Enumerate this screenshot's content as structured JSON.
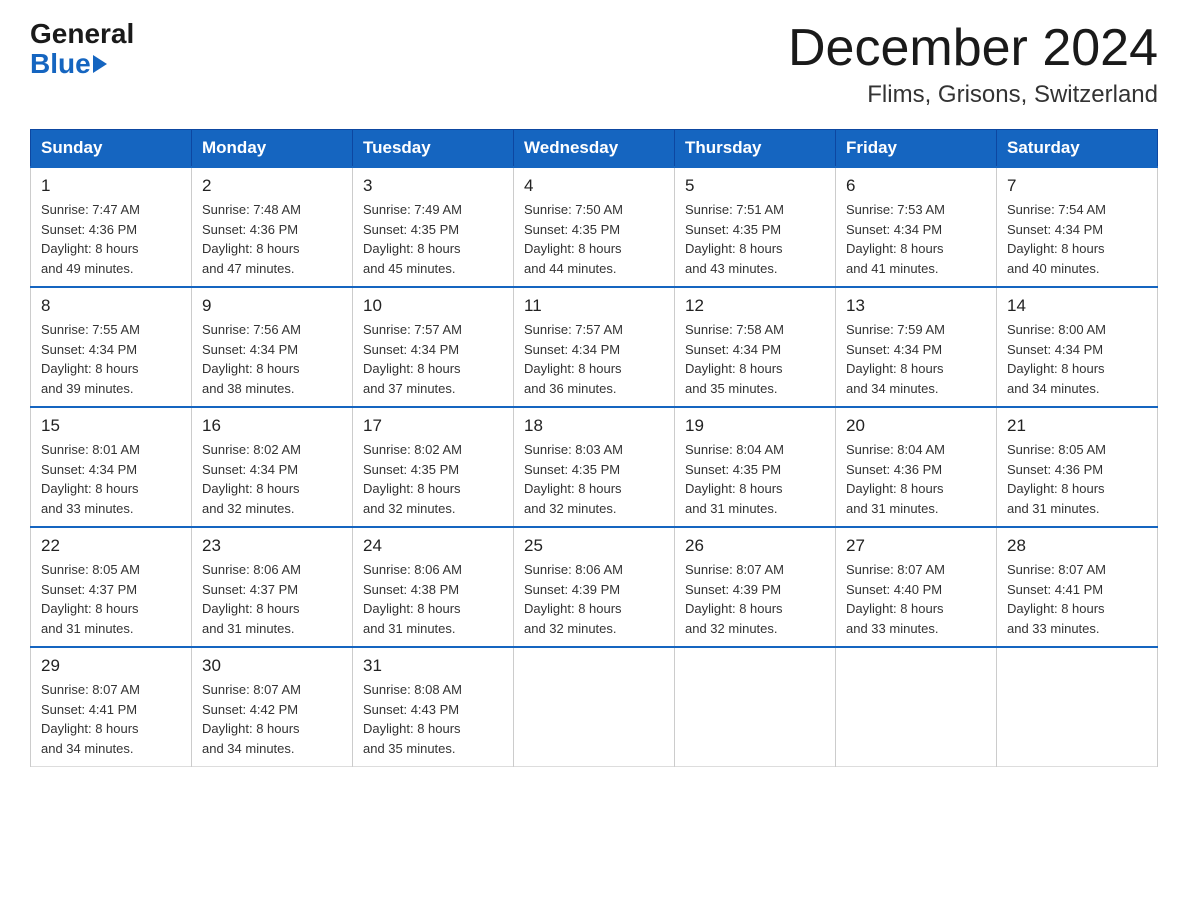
{
  "header": {
    "logo_general": "General",
    "logo_blue": "Blue",
    "month": "December 2024",
    "location": "Flims, Grisons, Switzerland"
  },
  "weekdays": [
    "Sunday",
    "Monday",
    "Tuesday",
    "Wednesday",
    "Thursday",
    "Friday",
    "Saturday"
  ],
  "weeks": [
    [
      {
        "day": "1",
        "sunrise": "7:47 AM",
        "sunset": "4:36 PM",
        "daylight": "8 hours and 49 minutes."
      },
      {
        "day": "2",
        "sunrise": "7:48 AM",
        "sunset": "4:36 PM",
        "daylight": "8 hours and 47 minutes."
      },
      {
        "day": "3",
        "sunrise": "7:49 AM",
        "sunset": "4:35 PM",
        "daylight": "8 hours and 45 minutes."
      },
      {
        "day": "4",
        "sunrise": "7:50 AM",
        "sunset": "4:35 PM",
        "daylight": "8 hours and 44 minutes."
      },
      {
        "day": "5",
        "sunrise": "7:51 AM",
        "sunset": "4:35 PM",
        "daylight": "8 hours and 43 minutes."
      },
      {
        "day": "6",
        "sunrise": "7:53 AM",
        "sunset": "4:34 PM",
        "daylight": "8 hours and 41 minutes."
      },
      {
        "day": "7",
        "sunrise": "7:54 AM",
        "sunset": "4:34 PM",
        "daylight": "8 hours and 40 minutes."
      }
    ],
    [
      {
        "day": "8",
        "sunrise": "7:55 AM",
        "sunset": "4:34 PM",
        "daylight": "8 hours and 39 minutes."
      },
      {
        "day": "9",
        "sunrise": "7:56 AM",
        "sunset": "4:34 PM",
        "daylight": "8 hours and 38 minutes."
      },
      {
        "day": "10",
        "sunrise": "7:57 AM",
        "sunset": "4:34 PM",
        "daylight": "8 hours and 37 minutes."
      },
      {
        "day": "11",
        "sunrise": "7:57 AM",
        "sunset": "4:34 PM",
        "daylight": "8 hours and 36 minutes."
      },
      {
        "day": "12",
        "sunrise": "7:58 AM",
        "sunset": "4:34 PM",
        "daylight": "8 hours and 35 minutes."
      },
      {
        "day": "13",
        "sunrise": "7:59 AM",
        "sunset": "4:34 PM",
        "daylight": "8 hours and 34 minutes."
      },
      {
        "day": "14",
        "sunrise": "8:00 AM",
        "sunset": "4:34 PM",
        "daylight": "8 hours and 34 minutes."
      }
    ],
    [
      {
        "day": "15",
        "sunrise": "8:01 AM",
        "sunset": "4:34 PM",
        "daylight": "8 hours and 33 minutes."
      },
      {
        "day": "16",
        "sunrise": "8:02 AM",
        "sunset": "4:34 PM",
        "daylight": "8 hours and 32 minutes."
      },
      {
        "day": "17",
        "sunrise": "8:02 AM",
        "sunset": "4:35 PM",
        "daylight": "8 hours and 32 minutes."
      },
      {
        "day": "18",
        "sunrise": "8:03 AM",
        "sunset": "4:35 PM",
        "daylight": "8 hours and 32 minutes."
      },
      {
        "day": "19",
        "sunrise": "8:04 AM",
        "sunset": "4:35 PM",
        "daylight": "8 hours and 31 minutes."
      },
      {
        "day": "20",
        "sunrise": "8:04 AM",
        "sunset": "4:36 PM",
        "daylight": "8 hours and 31 minutes."
      },
      {
        "day": "21",
        "sunrise": "8:05 AM",
        "sunset": "4:36 PM",
        "daylight": "8 hours and 31 minutes."
      }
    ],
    [
      {
        "day": "22",
        "sunrise": "8:05 AM",
        "sunset": "4:37 PM",
        "daylight": "8 hours and 31 minutes."
      },
      {
        "day": "23",
        "sunrise": "8:06 AM",
        "sunset": "4:37 PM",
        "daylight": "8 hours and 31 minutes."
      },
      {
        "day": "24",
        "sunrise": "8:06 AM",
        "sunset": "4:38 PM",
        "daylight": "8 hours and 31 minutes."
      },
      {
        "day": "25",
        "sunrise": "8:06 AM",
        "sunset": "4:39 PM",
        "daylight": "8 hours and 32 minutes."
      },
      {
        "day": "26",
        "sunrise": "8:07 AM",
        "sunset": "4:39 PM",
        "daylight": "8 hours and 32 minutes."
      },
      {
        "day": "27",
        "sunrise": "8:07 AM",
        "sunset": "4:40 PM",
        "daylight": "8 hours and 33 minutes."
      },
      {
        "day": "28",
        "sunrise": "8:07 AM",
        "sunset": "4:41 PM",
        "daylight": "8 hours and 33 minutes."
      }
    ],
    [
      {
        "day": "29",
        "sunrise": "8:07 AM",
        "sunset": "4:41 PM",
        "daylight": "8 hours and 34 minutes."
      },
      {
        "day": "30",
        "sunrise": "8:07 AM",
        "sunset": "4:42 PM",
        "daylight": "8 hours and 34 minutes."
      },
      {
        "day": "31",
        "sunrise": "8:08 AM",
        "sunset": "4:43 PM",
        "daylight": "8 hours and 35 minutes."
      },
      null,
      null,
      null,
      null
    ]
  ],
  "labels": {
    "sunrise": "Sunrise:",
    "sunset": "Sunset:",
    "daylight": "Daylight:"
  }
}
